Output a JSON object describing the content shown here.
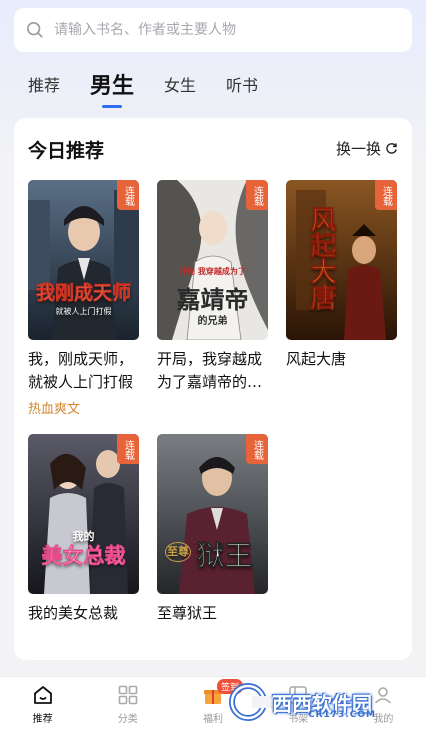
{
  "search": {
    "placeholder": "请输入书名、作者或主要人物"
  },
  "tabs": [
    {
      "label": "推荐",
      "active": false
    },
    {
      "label": "男生",
      "active": true
    },
    {
      "label": "女生",
      "active": false
    },
    {
      "label": "听书",
      "active": false
    }
  ],
  "section": {
    "title": "今日推荐",
    "refresh_label": "换一换"
  },
  "books": [
    {
      "title": "我，刚成天师，就被人上门打假",
      "tag": "热血爽文",
      "badge": "连载",
      "cover_title": "我刚成天师",
      "cover_sub": "就被人上门打假",
      "cover_colors": [
        "#3b4a5c",
        "#1e2a36",
        "#c8702a"
      ]
    },
    {
      "title": "开局，我穿越成为了嘉靖帝的兄弟",
      "tag": "",
      "badge": "连载",
      "cover_title": "嘉靖帝",
      "cover_sub": "开局 我穿越成为了",
      "cover_sub2": "的兄弟",
      "cover_colors": [
        "#e8e6e2",
        "#c9c5bf",
        "#5c5a58"
      ]
    },
    {
      "title": "风起大唐",
      "tag": "",
      "badge": "连载",
      "cover_title": "风起大唐",
      "cover_colors": [
        "#7a4a1c",
        "#3a1f0c",
        "#e0a030"
      ]
    },
    {
      "title": "我的美女总裁",
      "tag": "",
      "badge": "连载",
      "cover_title": "美女总裁",
      "cover_sub": "我的",
      "cover_colors": [
        "#4a4a58",
        "#1c1c24",
        "#e94a8c"
      ]
    },
    {
      "title": "至尊狱王",
      "tag": "",
      "badge": "连载",
      "cover_title": "狱王",
      "cover_sub": "至尊",
      "cover_colors": [
        "#6a6e70",
        "#2a2c2e",
        "#c8a24a"
      ]
    }
  ],
  "nav": [
    {
      "label": "推荐",
      "icon": "home-icon",
      "active": true
    },
    {
      "label": "分类",
      "icon": "grid-icon",
      "active": false
    },
    {
      "label": "福利",
      "icon": "gift-icon",
      "active": false,
      "badge": "签到"
    },
    {
      "label": "书架",
      "icon": "bookshelf-icon",
      "active": false
    },
    {
      "label": "我的",
      "icon": "profile-icon",
      "active": false
    }
  ],
  "watermark": {
    "text": "西西软件园",
    "sub": "CR173.COM"
  },
  "colors": {
    "accent": "#2f6cf6",
    "tag": "#d4882e",
    "badge": "#e7643a"
  }
}
